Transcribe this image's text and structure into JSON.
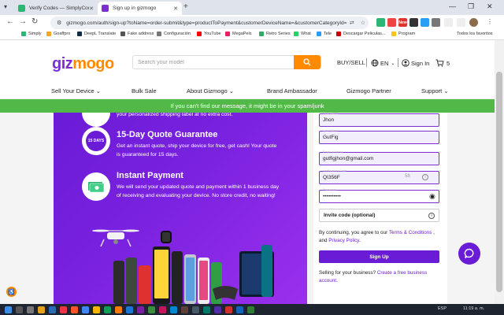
{
  "browser": {
    "tabs": [
      {
        "title": "Verify Codes — SimplyCodes",
        "active": false
      },
      {
        "title": "Sign up in gizmogo",
        "active": true
      }
    ],
    "url": "gizmogo.com/auth/sign-up?toName=order-submit&type=productToPayment&customerDeviceName=&customerCategoryId=&c...",
    "bookmarks": [
      "Simply",
      "Goaffpro",
      "DeepL Translate",
      "Fake address",
      "Configuración",
      "YouTube",
      "MegaPels",
      "Retro Series",
      "What",
      "Tele",
      "Descargar Peliculas...",
      "Program"
    ],
    "all_bookmarks": "Todos los favoritos",
    "ext_badge": "New"
  },
  "header": {
    "logo_part1": "giz",
    "logo_part2": "mogo",
    "search_placeholder": "Search your model",
    "buy_sell": "BUY/SELL",
    "language": "EN",
    "sign_in": "Sign In",
    "cart_count": "5"
  },
  "nav": [
    "Sell Your Device",
    "Bulk Sale",
    "About Gizmogo",
    "Brand Ambassador",
    "Gizmogo Partner",
    "Support"
  ],
  "banner": "If you can't find our message, it might be in your spam/junk",
  "promo": {
    "partial_text": "your personalized shipping label at no extra cost.",
    "features": [
      {
        "title": "15-Day Quote Guarantee",
        "badge": "15 DAYS",
        "desc": "Get an instant quote, ship your device for free, get cash! Your quote is guaranteed for 15 days."
      },
      {
        "title": "Instant Payment",
        "desc": "We will send your updated quote and payment within 1 business day of receiving and evaluating your device. No store credit, no waiting!"
      }
    ]
  },
  "form": {
    "first_name": {
      "label": "First Name",
      "value": "Jhon"
    },
    "last_name": {
      "label": "Last Name",
      "value": "GutFig"
    },
    "email": {
      "label": "Email address",
      "value": "gutfigjhon@gmail.com"
    },
    "code": {
      "label": "Verification Code",
      "value": "QI356F",
      "suffix": "58"
    },
    "password": {
      "label": "Password",
      "value": "••••••••••"
    },
    "invite_label": "Invite code (optional)",
    "terms_prefix": "By continuing, you agree to our",
    "terms_link": "Terms & Conditions",
    "terms_and": ", and",
    "privacy_link": "Privacy Policy",
    "terms_end": ".",
    "signup_button": "Sign Up",
    "selling_prefix": "Selling for your business?",
    "selling_link": "Create a free business account",
    "selling_end": "."
  },
  "taskbar": {
    "language": "ESP",
    "time": "11:19 a. m."
  },
  "colors": {
    "brand_purple": "#6a1bd6",
    "brand_orange": "#ff8a00",
    "banner_green": "#52b848"
  }
}
